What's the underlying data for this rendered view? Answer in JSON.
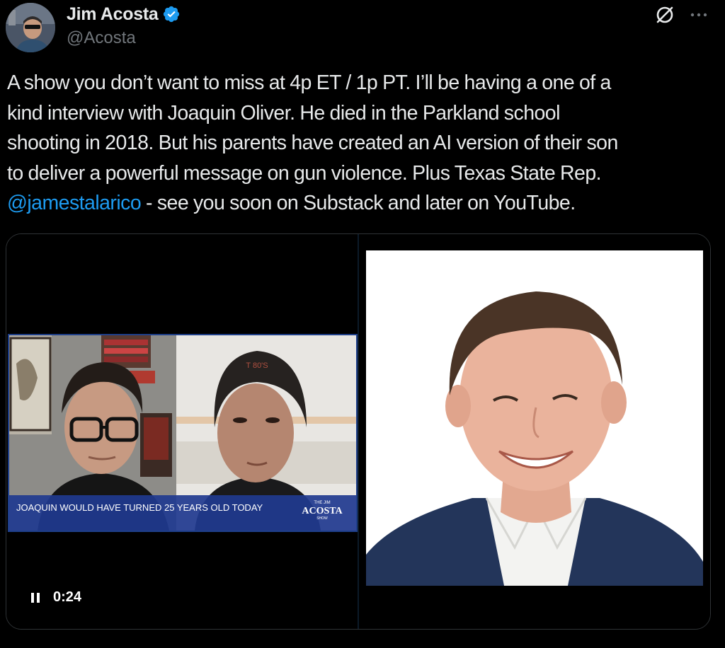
{
  "author": {
    "display_name": "Jim Acosta",
    "handle": "@Acosta",
    "verified": true
  },
  "icons": {
    "verified": "verified-badge-icon",
    "grok": "grok-icon",
    "more": "more-options-icon",
    "pause": "pause-icon"
  },
  "colors": {
    "background": "#000000",
    "text": "#e7e9ea",
    "secondary_text": "#71767b",
    "link": "#1d9bf0",
    "verified": "#1d9bf0"
  },
  "tweet": {
    "lines": [
      "A show you don’t want to miss at 4p ET / 1p PT. I’ll be having a one of a",
      "kind interview with Joaquin Oliver. He died in the Parkland school",
      "shooting in 2018. But his parents have created an AI version of their son",
      "to deliver a powerful message on gun violence. Plus Texas State Rep."
    ],
    "mention": "@jamestalarico",
    "last_line_rest": " - see you soon on Substack and later on YouTube."
  },
  "video": {
    "time": "0:24",
    "lower_third": "JOAQUIN WOULD HAVE TURNED 25 YEARS OLD TODAY",
    "logo_top": "THE JIM",
    "logo_main": "ACOSTA",
    "logo_bottom": "SHOW",
    "beanie_text": "T 80'S"
  }
}
